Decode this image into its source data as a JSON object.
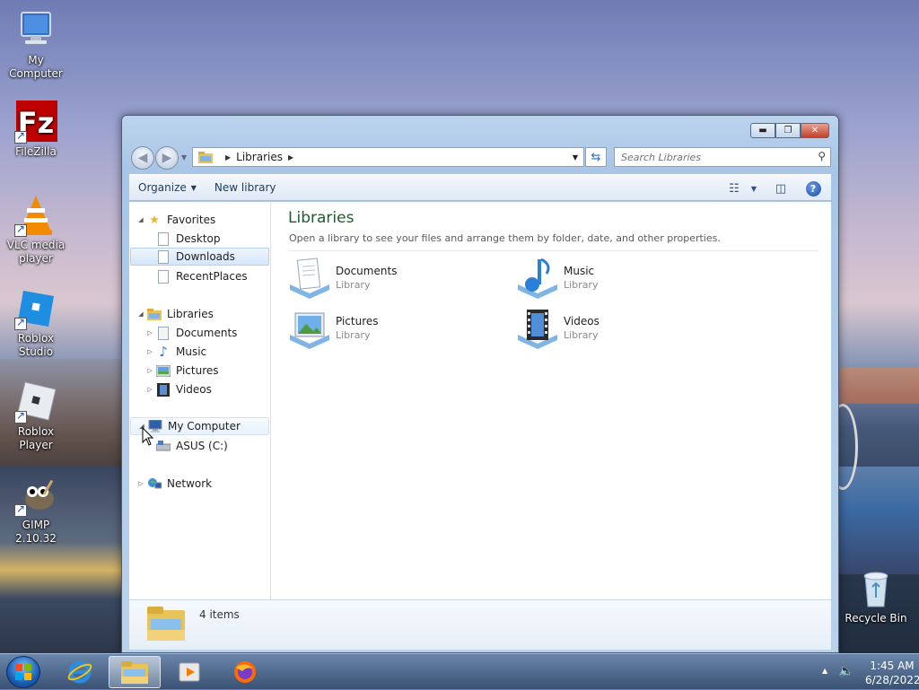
{
  "desktop": {
    "icons": [
      {
        "label": "My Computer",
        "icon": "computer-icon"
      },
      {
        "label": "FileZilla",
        "icon": "filezilla-icon"
      },
      {
        "label": "VLC media player",
        "icon": "vlc-icon"
      },
      {
        "label": "Roblox Studio",
        "icon": "roblox-studio-icon"
      },
      {
        "label": "Roblox Player",
        "icon": "roblox-player-icon"
      },
      {
        "label": "GIMP 2.10.32",
        "icon": "gimp-icon"
      },
      {
        "label": "Recycle Bin",
        "icon": "recycle-bin-icon"
      }
    ]
  },
  "window": {
    "address": {
      "crumb": "Libraries"
    },
    "search": {
      "placeholder": "Search Libraries"
    },
    "toolbar": {
      "organize": "Organize",
      "new_library": "New library"
    },
    "nav": {
      "favorites": "Favorites",
      "favorites_items": [
        "Desktop",
        "Downloads",
        "RecentPlaces"
      ],
      "libraries": "Libraries",
      "libraries_items": [
        "Documents",
        "Music",
        "Pictures",
        "Videos"
      ],
      "computer": "My Computer",
      "computer_items": [
        "ASUS (C:)"
      ],
      "network": "Network"
    },
    "content": {
      "title": "Libraries",
      "subtitle": "Open a library to see your files and arrange them by folder, date, and other properties.",
      "libraries": [
        {
          "name": "Documents",
          "kind": "Library"
        },
        {
          "name": "Music",
          "kind": "Library"
        },
        {
          "name": "Pictures",
          "kind": "Library"
        },
        {
          "name": "Videos",
          "kind": "Library"
        }
      ]
    },
    "details": {
      "count": "4 items"
    }
  },
  "taskbar": {
    "time": "1:45 AM",
    "date": "6/28/2022"
  },
  "colors": {
    "title_green": "#1e5d2a",
    "selection": "#d5e6f9",
    "close_red": "#c2412b"
  }
}
